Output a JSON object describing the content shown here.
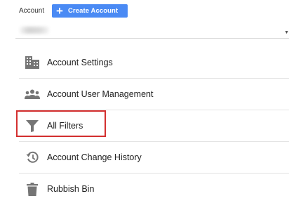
{
  "header": {
    "account_label": "Account",
    "create_button": {
      "icon": "plus-icon",
      "label": "Create Account",
      "color": "#4a8af4"
    }
  },
  "account_selector": {
    "value": "",
    "caret_icon": "caret-down-icon"
  },
  "menu": {
    "items": [
      {
        "label": "Account Settings",
        "icon": "building-icon"
      },
      {
        "label": "Account User Management",
        "icon": "people-icon"
      },
      {
        "label": "All Filters",
        "icon": "filter-icon",
        "highlighted": true
      },
      {
        "label": "Account Change History",
        "icon": "history-icon"
      },
      {
        "label": "Rubbish Bin",
        "icon": "trash-icon"
      }
    ]
  },
  "colors": {
    "icon_gray": "#757575",
    "highlight_border": "#d32f2f",
    "divider": "#e4e4e4"
  }
}
